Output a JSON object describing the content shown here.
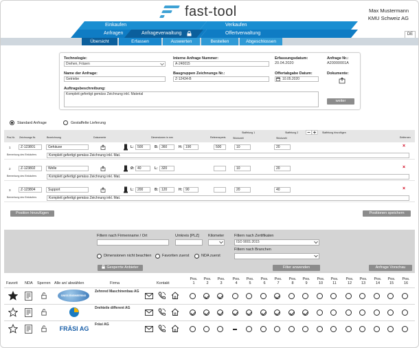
{
  "brand": {
    "name": "fast-tool",
    "accent": "#1a8ed1",
    "dark_accent": "#0b5f9c"
  },
  "user": {
    "name": "Max Mustermann",
    "company": "KMU Schweiz AG"
  },
  "language": "DE",
  "nav": {
    "einkaufen": "Einkaufen",
    "verkaufen": "Verkaufen",
    "anfragen": "Anfragen",
    "anfrageverwaltung": "Anfrageverwaltung",
    "offertverwaltung": "Offertverwaltung"
  },
  "tabs": [
    "Übersicht",
    "Erfassen",
    "Auswerten",
    "Bestellen",
    "Abgeschlossen"
  ],
  "form": {
    "technologie_label": "Technologie:",
    "technologie_value": "Drehen, Fräsen",
    "name_label": "Name der Anfrage:",
    "name_value": "Getriebe",
    "interne_nr_label": "Interne Anfrage Nummer:",
    "interne_nr_value": "A-240015",
    "baugruppe_label": "Baugruppen Zeichnungs Nr.:",
    "baugruppe_value": "Z-12434-B",
    "erfassung_label": "Erfassungsdatum:",
    "erfassung_value": "20.04.2020",
    "offertabgabe_label": "Offertabgabe Datum:",
    "offertabgabe_value": "10.05.2020",
    "anfrage_nr_label": "Anfrage Nr.:",
    "anfrage_nr_value": "A20000001A",
    "dokumente_label": "Dokumente:",
    "beschreibung_label": "Auftragsbeschreibung:",
    "beschreibung_value": "Komplett gefertigt gemäss Zeichnung inkl. Material",
    "weiter": "weiter"
  },
  "mode": {
    "standard": "Standard Anfrage",
    "gestaffelt": "Gestaffelte Lieferung"
  },
  "pos_headers": {
    "nr": "Pos.Nr.",
    "zeichnung": "Zeichnungs Nr.",
    "bezeichnung": "Bezeichnung",
    "dokumente": "Dokumente",
    "dimensionen": "Dimensionen in mm",
    "referenzpreis": "Referenzpreis",
    "staffelung1": "Staffelung 1",
    "staffelung2": "Staffelung 2",
    "stueckzahl": "Stückzahl",
    "staffelung_hinzu": "Staffelung hinzufügen",
    "entfernen": "Entfernen",
    "bemerkung": "Bemerkung des Einkäufers"
  },
  "positions": [
    {
      "nr": "1",
      "zeichnung": "Z-123801",
      "bezeichnung": "Gehäuse",
      "l": "500",
      "b": "360",
      "h": "190",
      "ref": "500",
      "s1": "10",
      "s2": "20",
      "bemerkung": "Komplett gefertigt gemäss Zeichnung inkl. Mat."
    },
    {
      "nr": "2",
      "zeichnung": "Z-123802",
      "bezeichnung": "Welle",
      "d": "40",
      "l": "320",
      "ref": "",
      "s1": "10",
      "s2": "20",
      "bemerkung": "Komplett gefertigt gemäss Zeichnung inkl. Mat."
    },
    {
      "nr": "3",
      "zeichnung": "Z-123804",
      "bezeichnung": "Support",
      "l": "200",
      "b": "120",
      "h": "90",
      "ref": "",
      "s1": "20",
      "s2": "40",
      "bemerkung": "Komplett gefertigt gemäss Zeichnung inkl. Mat."
    }
  ],
  "dim_letters": {
    "l": "L:",
    "b": "B:",
    "h": "H:",
    "d": "Ø:"
  },
  "pos_buttons": {
    "add": "Position hinzufügen",
    "save": "Positionen speichern"
  },
  "filter": {
    "firmenname_label": "Filtern nach Firmenname / Ort",
    "umkreis_label": "Umkreis [PLZ]",
    "kilometer_label": "Kilometer",
    "zertifikate_label": "Filtern nach Zertifikaten",
    "zertifikate_value": "ISO 9001:2015",
    "branchen_label": "Filtern nach Branchen",
    "dim_nicht": "Dimensionen nicht beachten",
    "favoriten": "Favoriten zuerst",
    "nda": "NDA zuerst",
    "gesperrte": "Gesperrte Anbieter",
    "anwenden": "Filter anwenden",
    "vorschau": "Anfrage Vorschau"
  },
  "sup_headers": {
    "favorit": "Favorit",
    "nda": "NDA",
    "sperren": "Sperren",
    "alle": "Alle an/ abwählen",
    "firma": "Firma",
    "kontakt": "Kontakt"
  },
  "pos_cols": [
    "1",
    "2",
    "3",
    "4",
    "5",
    "6",
    "7",
    "8",
    "9",
    "10",
    "11",
    "12",
    "13",
    "14",
    "15",
    "16"
  ],
  "pos_col_label": "Pos.",
  "suppliers": [
    {
      "firma": "Zehnred Maschinenbau AG",
      "logo": "SWISS ENGINEERING",
      "marks": [
        "o",
        "c",
        "c",
        "o",
        "o",
        "o",
        "c",
        "o",
        "o",
        "o",
        "o",
        "o",
        "o",
        "o",
        "o",
        "o"
      ]
    },
    {
      "firma": "Drehteile different AG",
      "logo": "",
      "marks": [
        "c",
        "c",
        "c",
        "c",
        "c",
        "c",
        "c",
        "c",
        "c",
        "o",
        "o",
        "o",
        "o",
        "o",
        "o",
        "o"
      ]
    },
    {
      "firma": "Fräsi AG",
      "logo": "FRÄSI AG",
      "marks": [
        "o",
        "o",
        "o",
        "d",
        "o",
        "o",
        "o",
        "o",
        "o",
        "o",
        "o",
        "o",
        "o",
        "o",
        "o",
        "o"
      ]
    }
  ],
  "icons": {
    "star": "star-icon",
    "document": "document-icon",
    "lock": "lock-icon",
    "mail": "mail-icon",
    "phone": "phone-icon",
    "house": "house-icon",
    "upload": "upload-icon",
    "calendar": "calendar-icon",
    "plus": "plus-icon",
    "minus": "minus-icon",
    "close": "close-icon"
  }
}
